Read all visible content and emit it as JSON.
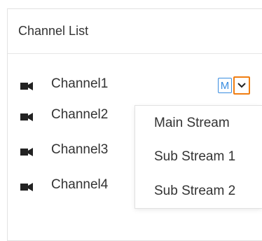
{
  "panel": {
    "title": "Channel List"
  },
  "channels": [
    {
      "label": "Channel1",
      "icon": "video-camera-icon"
    },
    {
      "label": "Channel2",
      "icon": "video-camera-icon"
    },
    {
      "label": "Channel3",
      "icon": "video-camera-icon"
    },
    {
      "label": "Channel4",
      "icon": "video-camera-icon"
    }
  ],
  "stream_badge": "M",
  "dropdown": {
    "options": [
      "Main Stream",
      "Sub Stream 1",
      "Sub Stream 2"
    ]
  },
  "colors": {
    "accent_blue": "#3a8de0",
    "focus_orange": "#f07e12"
  }
}
